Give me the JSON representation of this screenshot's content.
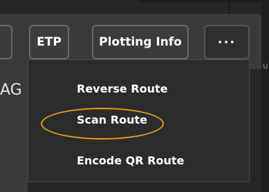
{
  "toolbar": {
    "etp_label": "ETP",
    "plotting_info_label": "Plotting Info",
    "more_label": "···"
  },
  "side_panel": {
    "partial_text": "AG"
  },
  "menu": {
    "items": [
      {
        "label": "Reverse Route"
      },
      {
        "label": "Scan Route"
      },
      {
        "label": "Encode QR Route"
      }
    ]
  },
  "colors": {
    "highlight": "#e8a21c",
    "panel": "#3a3a3a",
    "menu_bg": "#2c2c2c"
  },
  "right_edge": {
    "partial_text": "u"
  }
}
